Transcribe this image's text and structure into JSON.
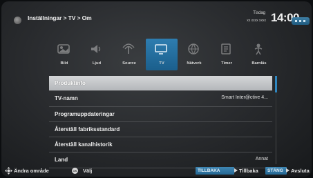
{
  "header": {
    "breadcrumb": "Inställningar > TV > Om",
    "date_day": "Tisdag",
    "date_value": "xx xxxx xxxx",
    "clock": "14:00"
  },
  "categories": [
    {
      "label": "Bild",
      "icon": "picture-icon",
      "active": false
    },
    {
      "label": "Ljud",
      "icon": "speaker-icon",
      "active": false
    },
    {
      "label": "Source",
      "icon": "source-input-icon",
      "active": false
    },
    {
      "label": "TV",
      "icon": "tv-icon",
      "active": true
    },
    {
      "label": "Nätverk",
      "icon": "network-globe-icon",
      "active": false
    },
    {
      "label": "Timer",
      "icon": "timer-icon",
      "active": false
    },
    {
      "label": "Barnlås",
      "icon": "child-lock-icon",
      "active": false
    }
  ],
  "menu": [
    {
      "label": "Produktinfo",
      "value": "",
      "selected": true
    },
    {
      "label": "TV-namn",
      "value": "Smart Inter@ctive 4...",
      "selected": false
    },
    {
      "label": "Programuppdateringar",
      "value": "",
      "selected": false
    },
    {
      "label": "Återställ fabriksstandard",
      "value": "",
      "selected": false
    },
    {
      "label": "Återställ kanalhistorik",
      "value": "",
      "selected": false
    },
    {
      "label": "Land",
      "value": "Annat",
      "selected": false
    }
  ],
  "footer": {
    "change_area": "Ändra område",
    "ok_key": "OK",
    "select": "Välj",
    "back_key": "TILLBAKA",
    "back": "Tillbaka",
    "close_key": "STÄNG",
    "exit": "Avsluta"
  },
  "colors": {
    "accent": "#2e7db0",
    "selected_row": "#c4c6c8",
    "background": "#2a2c2f"
  }
}
